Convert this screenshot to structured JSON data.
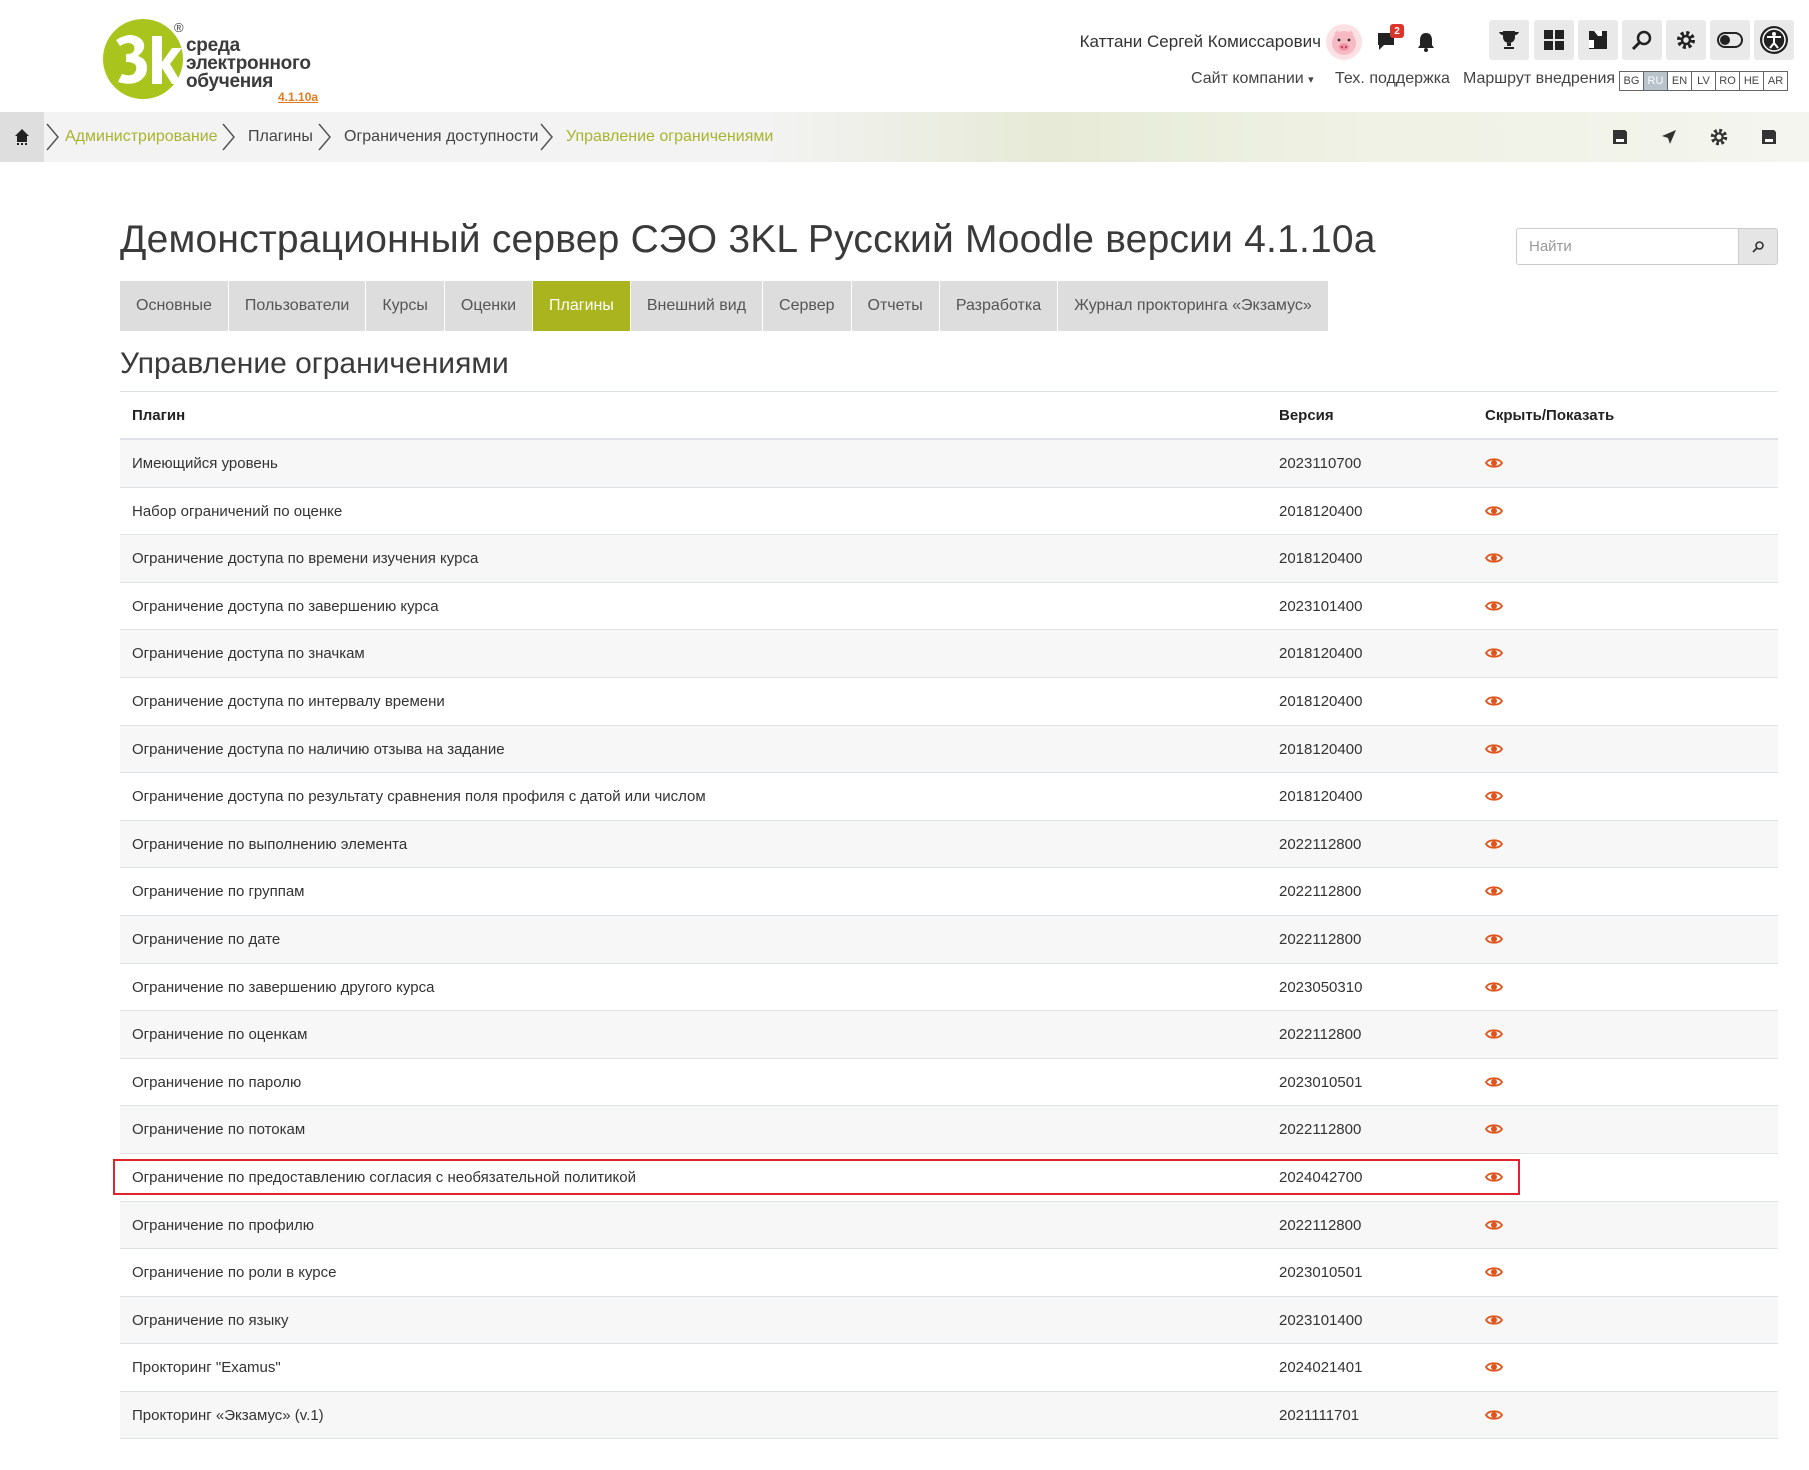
{
  "header": {
    "logo_lines": [
      "среда",
      "электронного",
      "обучения"
    ],
    "logo_reg": "®",
    "logo_version": "4.1.10a",
    "user_name": "Каттани Сергей Комиссарович",
    "message_count": "2",
    "top_links": [
      "Сайт компании",
      "Тех. поддержка",
      "Маршрут внедрения"
    ],
    "languages": [
      "BG",
      "RU",
      "EN",
      "LV",
      "RO",
      "HE",
      "AR"
    ],
    "active_language": "RU",
    "icons": [
      "chat-icon",
      "bell-icon",
      "trophy-icon",
      "dashboard-icon",
      "puzzle-icon",
      "search-icon",
      "gear-icon",
      "toggle-icon",
      "accessibility-icon"
    ]
  },
  "breadcrumb": {
    "items": [
      "Администрирование",
      "Плагины",
      "Ограничения доступности",
      "Управление ограничениями"
    ]
  },
  "page": {
    "title": "Демонстрационный сервер СЭО 3KL Русский Moodle версии 4.1.10a",
    "search_placeholder": "Найти",
    "section_title": "Управление ограничениями"
  },
  "tabs": [
    {
      "label": "Основные",
      "active": false
    },
    {
      "label": "Пользователи",
      "active": false
    },
    {
      "label": "Курсы",
      "active": false
    },
    {
      "label": "Оценки",
      "active": false
    },
    {
      "label": "Плагины",
      "active": true
    },
    {
      "label": "Внешний вид",
      "active": false
    },
    {
      "label": "Сервер",
      "active": false
    },
    {
      "label": "Отчеты",
      "active": false
    },
    {
      "label": "Разработка",
      "active": false
    },
    {
      "label": "Журнал прокторинга «Экзамус»",
      "active": false
    }
  ],
  "table": {
    "headers": {
      "plugin": "Плагин",
      "version": "Версия",
      "toggle": "Скрыть/Показать"
    },
    "rows": [
      {
        "name": "Имеющийся уровень",
        "version": "2023110700"
      },
      {
        "name": "Набор ограничений по оценке",
        "version": "2018120400"
      },
      {
        "name": "Ограничение доступа по времени изучения курса",
        "version": "2018120400"
      },
      {
        "name": "Ограничение доступа по завершению курса",
        "version": "2023101400"
      },
      {
        "name": "Ограничение доступа по значкам",
        "version": "2018120400"
      },
      {
        "name": "Ограничение доступа по интервалу времени",
        "version": "2018120400"
      },
      {
        "name": "Ограничение доступа по наличию отзыва на задание",
        "version": "2018120400"
      },
      {
        "name": "Ограничение доступа по результату сравнения поля профиля с датой или числом",
        "version": "2018120400"
      },
      {
        "name": "Ограничение по выполнению элемента",
        "version": "2022112800"
      },
      {
        "name": "Ограничение по группам",
        "version": "2022112800"
      },
      {
        "name": "Ограничение по дате",
        "version": "2022112800"
      },
      {
        "name": "Ограничение по завершению другого курса",
        "version": "2023050310"
      },
      {
        "name": "Ограничение по оценкам",
        "version": "2022112800"
      },
      {
        "name": "Ограничение по паролю",
        "version": "2023010501"
      },
      {
        "name": "Ограничение по потокам",
        "version": "2022112800"
      },
      {
        "name": "Ограничение по предоставлению согласия с необязательной политикой",
        "version": "2024042700"
      },
      {
        "name": "Ограничение по профилю",
        "version": "2022112800"
      },
      {
        "name": "Ограничение по роли в курсе",
        "version": "2023010501"
      },
      {
        "name": "Ограничение по языку",
        "version": "2023101400"
      },
      {
        "name": "Прокторинг \"Examus\"",
        "version": "2024021401"
      },
      {
        "name": "Прокторинг «Экзамус» (v.1)",
        "version": "2021111701"
      }
    ],
    "highlighted_row": 15
  },
  "colors": {
    "accent": "#a9b41e",
    "link": "#a8b42e",
    "eye": "#e0541a",
    "highlight_border": "#e0242a"
  }
}
